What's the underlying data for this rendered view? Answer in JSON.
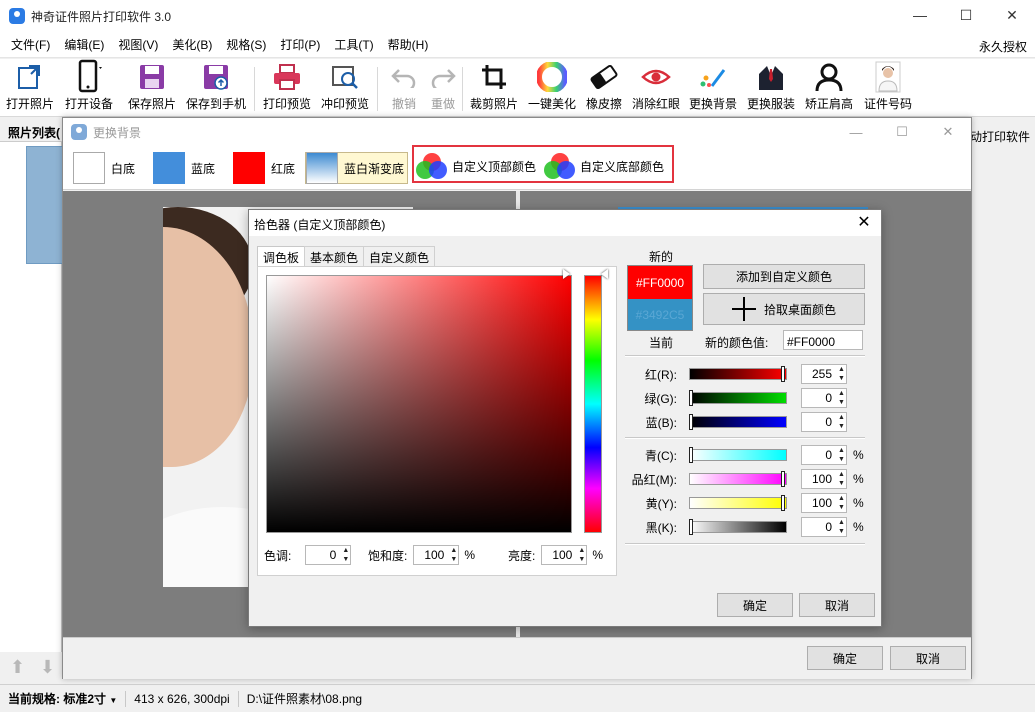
{
  "app": {
    "title": "神奇证件照片打印软件 3.0"
  },
  "menu": {
    "items": [
      "文件(F)",
      "编辑(E)",
      "视图(V)",
      "美化(B)",
      "规格(S)",
      "打印(P)",
      "工具(T)",
      "帮助(H)"
    ],
    "right": "永久授权"
  },
  "toolbar": {
    "open_photo": "打开照片",
    "open_device": "打开设备",
    "save_photo": "保存照片",
    "save_to_phone": "保存到手机",
    "print_preview": "打印预览",
    "develop_preview": "冲印预览",
    "undo": "撤销",
    "redo": "重做",
    "crop": "裁剪照片",
    "beautify": "一键美化",
    "eraser": "橡皮擦",
    "redeye": "消除红眼",
    "change_bg": "更换背景",
    "change_clothes": "更换服装",
    "fix_shoulder": "矫正肩高",
    "id_number": "证件号码"
  },
  "photo_list": {
    "header": "照片列表(",
    "right_partial": "动打印软件"
  },
  "status": {
    "spec_label": "当前规格:",
    "spec_value": "标准2寸",
    "size": "413 x 626, 300dpi",
    "path": "D:\\证件照素材\\08.png"
  },
  "bg_dialog": {
    "title": "更换背景",
    "options": {
      "white": "白底",
      "blue": "蓝底",
      "red": "红底",
      "gradient": "蓝白渐变底",
      "custom_top": "自定义顶部颜色",
      "custom_bottom": "自定义底部颜色"
    },
    "ok": "确定",
    "cancel": "取消"
  },
  "color_picker": {
    "title": "拾色器 (自定义顶部颜色)",
    "tabs": [
      "调色板",
      "基本颜色",
      "自定义颜色"
    ],
    "hue_label": "色调:",
    "hue": "0",
    "sat_label": "饱和度:",
    "sat": "100",
    "bright_label": "亮度:",
    "bright": "100",
    "percent": "%",
    "new_label": "新的",
    "current_label": "当前",
    "new_hex": "#FF0000",
    "current_hex": "#3492C5",
    "add_custom": "添加到自定义颜色",
    "pick_desktop": "拾取桌面颜色",
    "new_value_label": "新的颜色值:",
    "new_value": "#FF0000",
    "rgb": [
      {
        "label": "红(R):",
        "value": "255",
        "level": 1.0
      },
      {
        "label": "绿(G):",
        "value": "0",
        "level": 0.0
      },
      {
        "label": "蓝(B):",
        "value": "0",
        "level": 0.0
      }
    ],
    "cmyk": [
      {
        "label": "青(C):",
        "value": "0",
        "level": 0.0
      },
      {
        "label": "品红(M):",
        "value": "100",
        "level": 1.0
      },
      {
        "label": "黄(Y):",
        "value": "100",
        "level": 1.0
      },
      {
        "label": "黑(K):",
        "value": "0",
        "level": 0.0
      }
    ],
    "ok": "确定",
    "cancel": "取消"
  },
  "colors": {
    "new_color": "#FF0000",
    "current_color": "#3492C5",
    "highlight_border": "#E3343F"
  }
}
